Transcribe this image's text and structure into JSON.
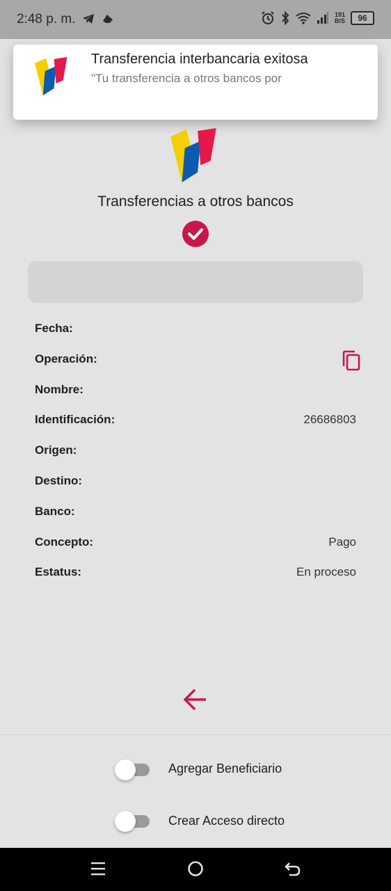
{
  "status_bar": {
    "time": "2:48 p. m.",
    "speed_value": "191",
    "speed_unit": "B/S",
    "battery": "96"
  },
  "notification": {
    "title": "Transferencia interbancaria exitosa",
    "body": "\"Tu transferencia a otros bancos por"
  },
  "page": {
    "title": "Transferencias a otros bancos"
  },
  "details": [
    {
      "label": "Fecha:",
      "value": ""
    },
    {
      "label": "Operación:",
      "value": ""
    },
    {
      "label": "Nombre:",
      "value": ""
    },
    {
      "label": "Identificación:",
      "value": "26686803"
    },
    {
      "label": "Origen:",
      "value": ""
    },
    {
      "label": "Destino:",
      "value": ""
    },
    {
      "label": "Banco:",
      "value": ""
    },
    {
      "label": "Concepto:",
      "value": "Pago"
    },
    {
      "label": "Estatus:",
      "value": "En proceso"
    }
  ],
  "toggles": {
    "add_beneficiary": {
      "label": "Agregar Beneficiario",
      "on": false
    },
    "create_shortcut": {
      "label": "Crear Acceso directo",
      "on": false
    }
  },
  "colors": {
    "accent": "#c8174a",
    "yellow": "#f6cf00",
    "blue": "#0d5bb0",
    "red": "#e5184a"
  },
  "icons": {
    "success": "check-circle-icon",
    "copy": "copy-icon",
    "back": "arrow-left-icon"
  }
}
